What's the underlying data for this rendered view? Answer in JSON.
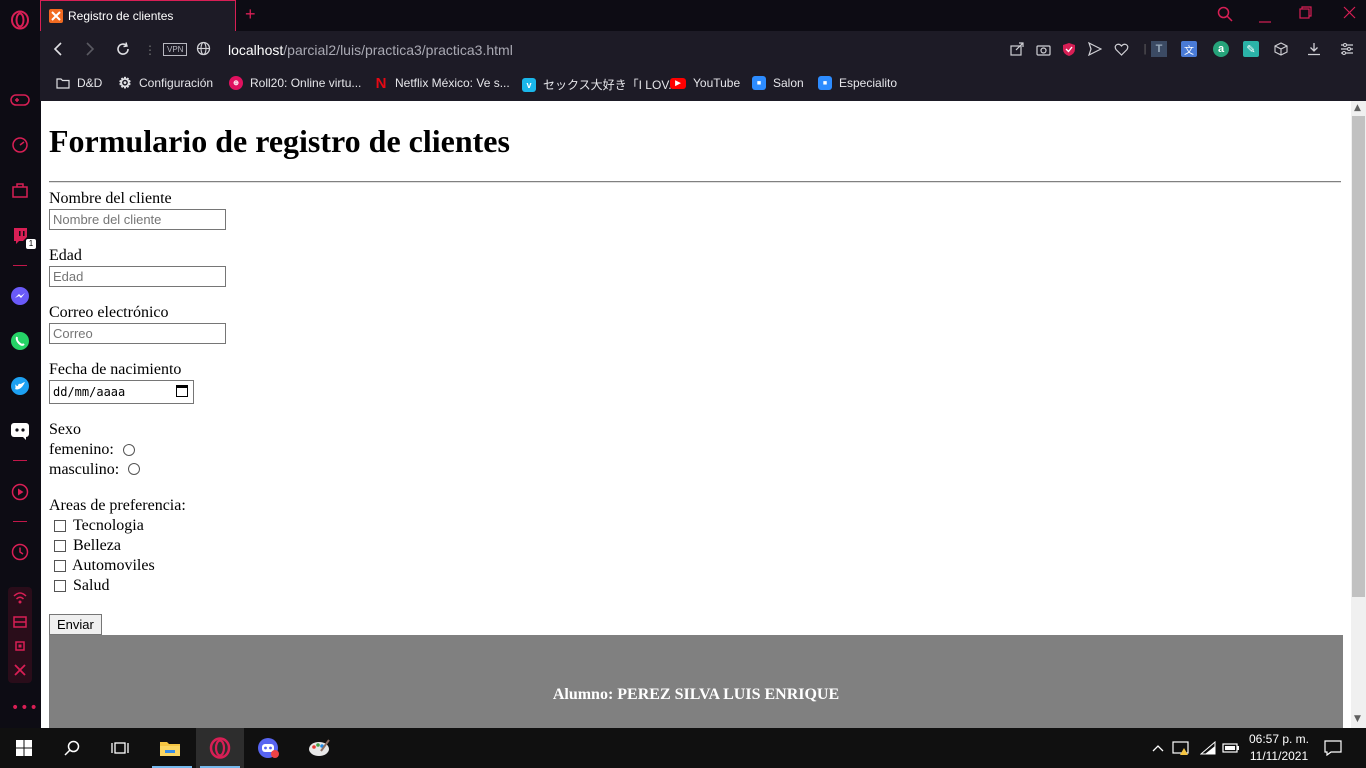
{
  "browser": {
    "tab_title": "Registro de clientes",
    "url_host": "localhost",
    "url_path": "/parcial2/luis/practica3/practica3.html",
    "vpn_label": "VPN",
    "accent_color": "#d81f55",
    "bookmarks": [
      {
        "label": "D&D",
        "icon": "folder-icon"
      },
      {
        "label": "Configuración",
        "icon": "gear-icon"
      },
      {
        "label": "Roll20: Online virtu...",
        "icon": "roll20-icon"
      },
      {
        "label": "Netflix México: Ve s...",
        "icon": "netflix-icon"
      },
      {
        "label": "セックス大好き「I LOV...",
        "icon": "vimeo-icon"
      },
      {
        "label": "YouTube",
        "icon": "youtube-icon"
      },
      {
        "label": "Salon",
        "icon": "zoom-icon"
      },
      {
        "label": "Especialito",
        "icon": "zoom-icon"
      }
    ],
    "sidebar_badge": "1"
  },
  "page": {
    "heading": "Formulario de registro de clientes",
    "fields": {
      "nombre": {
        "label": "Nombre del cliente",
        "placeholder": "Nombre del cliente"
      },
      "edad": {
        "label": "Edad",
        "placeholder": "Edad"
      },
      "correo": {
        "label": "Correo electrónico",
        "placeholder": "Correo"
      },
      "fecha": {
        "label": "Fecha de nacimiento",
        "value": "dd/mm/aaaa"
      }
    },
    "sexo": {
      "label": "Sexo",
      "options": [
        "femenino:",
        "masculino:"
      ]
    },
    "areas": {
      "label": "Areas de preferencia:",
      "options": [
        "Tecnologia",
        "Belleza",
        "Automoviles",
        "Salud"
      ]
    },
    "submit_label": "Enviar",
    "footer": {
      "alumno": "Alumno: PEREZ SILVA LUIS ENRIQUE"
    }
  },
  "taskbar": {
    "time": "06:57 p. m.",
    "date": "11/11/2021"
  }
}
